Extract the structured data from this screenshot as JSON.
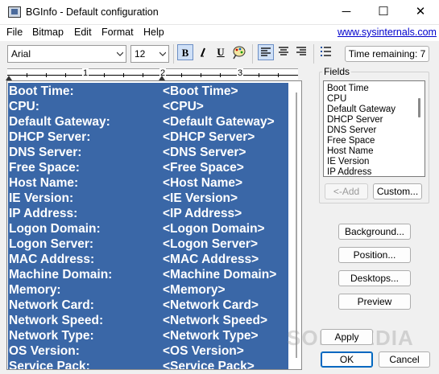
{
  "window": {
    "title": "BGInfo - Default configuration",
    "minimize_glyph": "─",
    "maximize_glyph": "☐",
    "close_glyph": "✕"
  },
  "menu": {
    "items": [
      "File",
      "Bitmap",
      "Edit",
      "Format",
      "Help"
    ],
    "link": "www.sysinternals.com"
  },
  "toolbar": {
    "font_name": "Arial",
    "font_size": "12",
    "bold_glyph": "B",
    "italic_glyph": "I",
    "underline_glyph": "U",
    "time_remaining": "Time remaining: 7",
    "pressed_buttons": [
      "bold",
      "align-left"
    ]
  },
  "ruler": {
    "numbers": [
      "1",
      "2",
      "3"
    ]
  },
  "editor": {
    "rows": [
      {
        "label": "Boot Time:",
        "value": "<Boot Time>"
      },
      {
        "label": "CPU:",
        "value": "<CPU>"
      },
      {
        "label": "Default Gateway:",
        "value": "<Default Gateway>"
      },
      {
        "label": "DHCP Server:",
        "value": "<DHCP Server>"
      },
      {
        "label": "DNS Server:",
        "value": "<DNS Server>"
      },
      {
        "label": "Free Space:",
        "value": "<Free Space>"
      },
      {
        "label": "Host Name:",
        "value": "<Host Name>"
      },
      {
        "label": "IE Version:",
        "value": "<IE Version>"
      },
      {
        "label": "IP Address:",
        "value": "<IP Address>"
      },
      {
        "label": "Logon Domain:",
        "value": "<Logon Domain>"
      },
      {
        "label": "Logon Server:",
        "value": "<Logon Server>"
      },
      {
        "label": "MAC Address:",
        "value": "<MAC Address>"
      },
      {
        "label": "Machine Domain:",
        "value": "<Machine Domain>"
      },
      {
        "label": "Memory:",
        "value": "<Memory>"
      },
      {
        "label": "Network Card:",
        "value": "<Network Card>"
      },
      {
        "label": "Network Speed:",
        "value": "<Network Speed>"
      },
      {
        "label": "Network Type:",
        "value": "<Network Type>"
      },
      {
        "label": "OS Version:",
        "value": "<OS Version>"
      },
      {
        "label": "Service Pack:",
        "value": "<Service Pack>"
      }
    ],
    "selection_color": "#3a67a7"
  },
  "fields": {
    "legend": "Fields",
    "items": [
      "Boot Time",
      "CPU",
      "Default Gateway",
      "DHCP Server",
      "DNS Server",
      "Free Space",
      "Host Name",
      "IE Version",
      "IP Address"
    ],
    "add_label": "<-Add",
    "custom_label": "Custom..."
  },
  "buttons": {
    "background": "Background...",
    "position": "Position...",
    "desktops": "Desktops...",
    "preview": "Preview",
    "apply": "Apply",
    "ok": "OK",
    "cancel": "Cancel"
  },
  "watermark": "SOFTPEDIA"
}
